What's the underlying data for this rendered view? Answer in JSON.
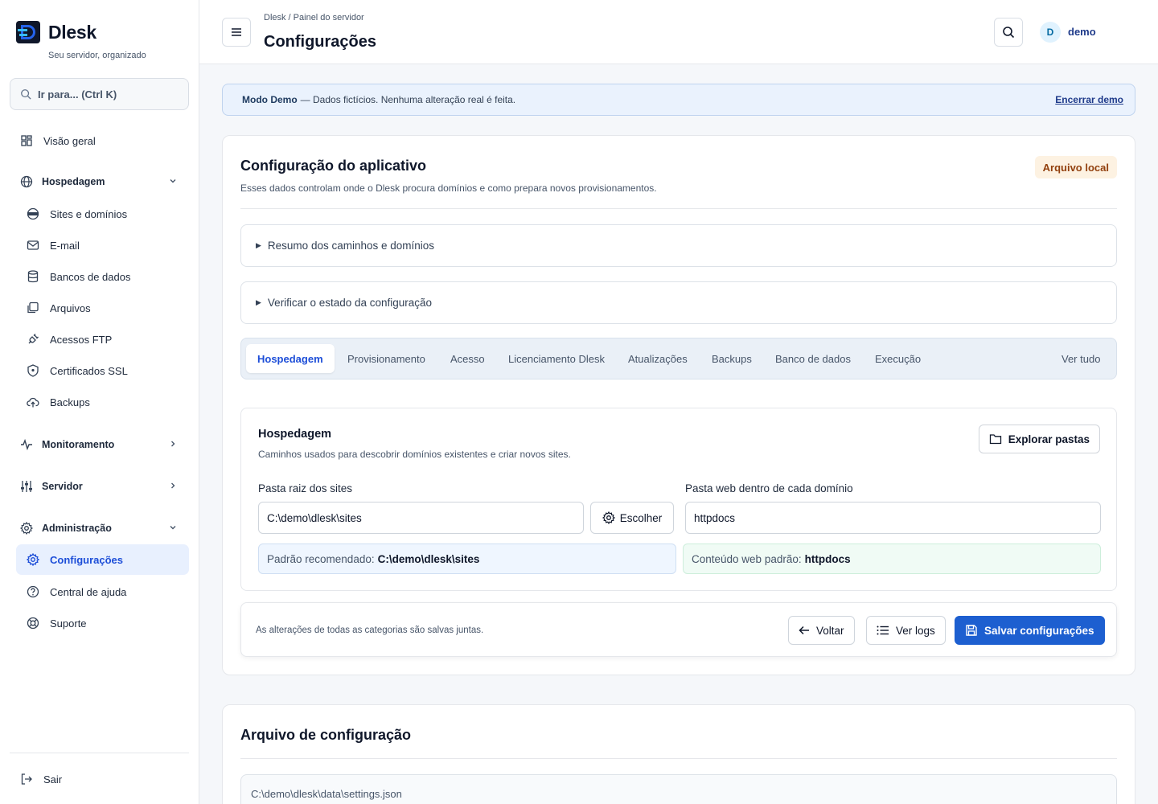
{
  "app": {
    "name": "Dlesk",
    "tagline": "Seu servidor, organizado"
  },
  "sidebar": {
    "search_placeholder": "Ir para... (Ctrl K)",
    "overview": "Visão geral",
    "groups": {
      "hosting": "Hospedagem",
      "monitoring": "Monitoramento",
      "server": "Servidor",
      "admin": "Administração"
    },
    "hosting_items": [
      "Sites e domínios",
      "E-mail",
      "Bancos de dados",
      "Arquivos",
      "Acessos FTP",
      "Certificados SSL",
      "Backups"
    ],
    "admin_items": [
      "Configurações",
      "Central de ajuda",
      "Suporte"
    ],
    "logout": "Sair"
  },
  "header": {
    "breadcrumb": "Dlesk / Painel do servidor",
    "title": "Configurações",
    "user_initial": "D",
    "user_name": "demo"
  },
  "banner": {
    "label": "Modo Demo",
    "text": "— Dados fictícios. Nenhuma alteração real é feita.",
    "action": "Encerrar demo"
  },
  "app_config": {
    "title": "Configuração do aplicativo",
    "description": "Esses dados controlam onde o Dlesk procura domínios e como prepara novos provisionamentos.",
    "badge": "Arquivo local",
    "summary_toggle": "Resumo dos caminhos e domínios",
    "verify_toggle": "Verificar o estado da configuração",
    "tabs": [
      "Hospedagem",
      "Provisionamento",
      "Acesso",
      "Licenciamento Dlesk",
      "Atualizações",
      "Backups",
      "Banco de dados",
      "Execução"
    ],
    "active_tab": "Hospedagem",
    "view_all": "Ver tudo"
  },
  "hosting_section": {
    "title": "Hospedagem",
    "description": "Caminhos usados para descobrir domínios existentes e criar novos sites.",
    "explore_button": "Explorar pastas",
    "sites_root_label": "Pasta raiz dos sites",
    "sites_root_value": "C:\\demo\\dlesk\\sites",
    "choose_button": "Escolher",
    "web_folder_label": "Pasta web dentro de cada domínio",
    "web_folder_value": "httpdocs",
    "recommended_label": "Padrão recomendado:",
    "recommended_value": "C:\\demo\\dlesk\\sites",
    "web_default_label": "Conteúdo web padrão:",
    "web_default_value": "httpdocs"
  },
  "footer": {
    "note": "As alterações de todas as categorias são salvas juntas.",
    "back": "Voltar",
    "logs": "Ver logs",
    "save": "Salvar configurações"
  },
  "config_file": {
    "title": "Arquivo de configuração",
    "path": "C:\\demo\\dlesk\\data\\settings.json"
  },
  "colors": {
    "primary": "#1d5fd0",
    "active_nav_bg": "#e8f0fe",
    "badge_bg": "#fdf2e2",
    "badge_text": "#92400e",
    "banner_bg": "#eaf2fd"
  }
}
